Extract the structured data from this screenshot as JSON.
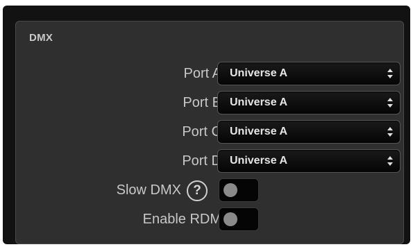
{
  "section": {
    "title": "DMX"
  },
  "ports": [
    {
      "label": "Port A",
      "value": "Universe A"
    },
    {
      "label": "Port B",
      "value": "Universe A"
    },
    {
      "label": "Port C",
      "value": "Universe A"
    },
    {
      "label": "Port D",
      "value": "Universe A"
    }
  ],
  "slow_dmx": {
    "label": "Slow DMX",
    "help_glyph": "?",
    "enabled": false
  },
  "enable_rdm": {
    "label": "Enable RDM",
    "enabled": false
  },
  "colors": {
    "panel": "#2f2f2f",
    "outer": "#121212",
    "text": "#c8c8c8",
    "control": "#050505"
  },
  "icons": {
    "select_arrows": "updown-arrows-icon",
    "help": "help-icon"
  }
}
